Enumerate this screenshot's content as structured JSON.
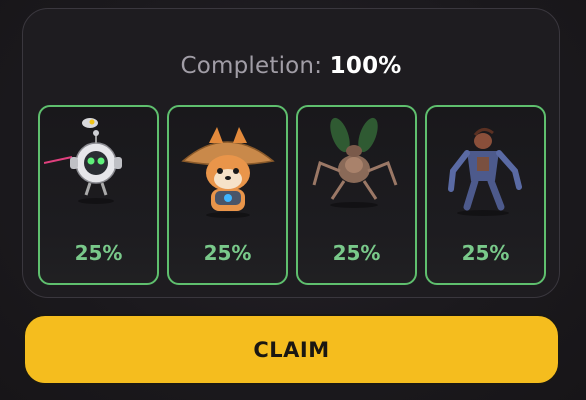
{
  "completion": {
    "label": "Completion:",
    "value": "100%"
  },
  "cards": [
    {
      "name": "robot-drone-icon",
      "percent": "25%"
    },
    {
      "name": "shiba-samurai-icon",
      "percent": "25%"
    },
    {
      "name": "mech-insect-icon",
      "percent": "25%"
    },
    {
      "name": "cyborg-monster-icon",
      "percent": "25%"
    }
  ],
  "claim_button": {
    "label": "CLAIM"
  },
  "colors": {
    "card_border": "#5fbf6e",
    "percent_text": "#79c98a",
    "claim_bg": "#f5bd1e"
  }
}
